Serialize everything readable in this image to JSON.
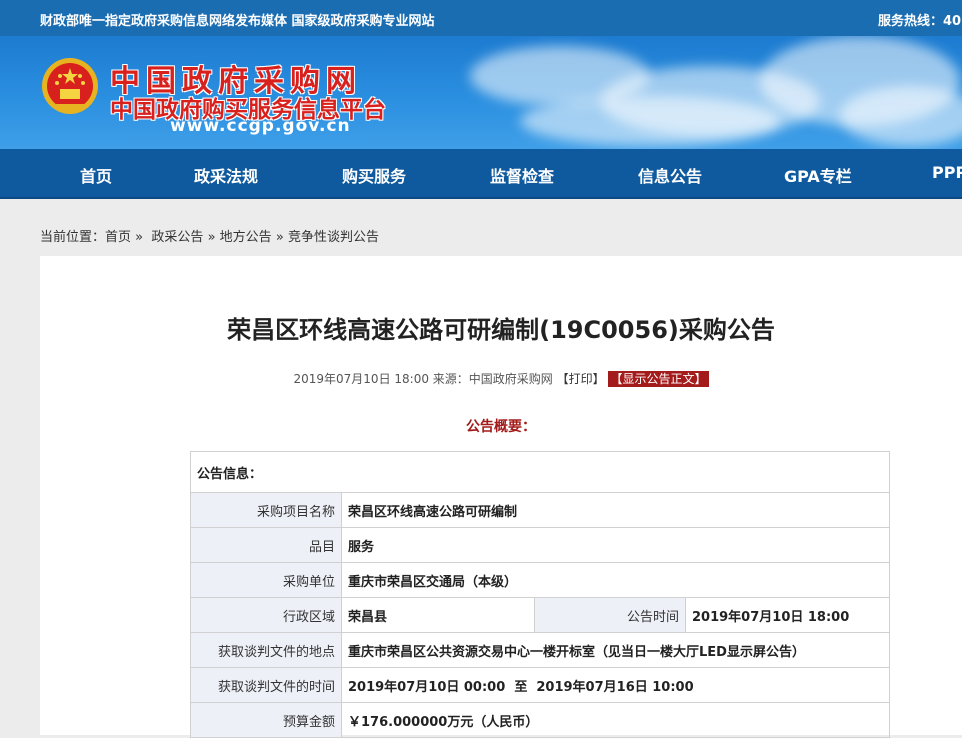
{
  "topbar": {
    "left_text": "财政部唯一指定政府采购信息网络发布媒体 国家级政府采购专业网站",
    "hotline": "服务热线：40"
  },
  "banner": {
    "title": "中国政府采购网",
    "subtitle": "中国政府购买服务信息平台",
    "url": "www.ccgp.gov.cn"
  },
  "nav": {
    "items": [
      "首页",
      "政采法规",
      "购买服务",
      "监督检查",
      "信息公告",
      "GPA专栏",
      "PPP"
    ]
  },
  "breadcrumb": {
    "prefix": "当前位置：",
    "items": [
      "首页",
      "政采公告",
      "地方公告",
      "竞争性谈判公告"
    ],
    "separator": "»"
  },
  "article": {
    "title": "荣昌区环线高速公路可研编制(19C0056)采购公告",
    "date": "2019年07月10日 18:00",
    "source": "来源：中国政府采购网",
    "print_label": "【打印】",
    "show_label": "【显示公告正文】",
    "summary_label": "公告概要："
  },
  "info_table": {
    "header": "公告信息：",
    "rows": [
      {
        "label": "采购项目名称",
        "value": "荣昌区环线高速公路可研编制"
      },
      {
        "label": "品目",
        "value": "服务"
      },
      {
        "label": "采购单位",
        "value": "重庆市荣昌区交通局（本级）"
      },
      {
        "label": "行政区域",
        "value": "荣昌县",
        "label2": "公告时间",
        "value2": "2019年07月10日 18:00"
      },
      {
        "label": "获取谈判文件的地点",
        "value": "重庆市荣昌区公共资源交易中心一楼开标室（见当日一楼大厅LED显示屏公告）"
      },
      {
        "label": "获取谈判文件的时间",
        "value": "2019年07月10日 00:00  至  2019年07月16日 10:00"
      },
      {
        "label": "预算金额",
        "value": "￥176.000000万元（人民币）"
      }
    ]
  },
  "colors": {
    "topbar": "#1b6db2",
    "nav": "#0f5a9e",
    "logo_red": "#d8201d",
    "accent_red": "#a31b1b",
    "label_bg": "#eef0f8"
  }
}
